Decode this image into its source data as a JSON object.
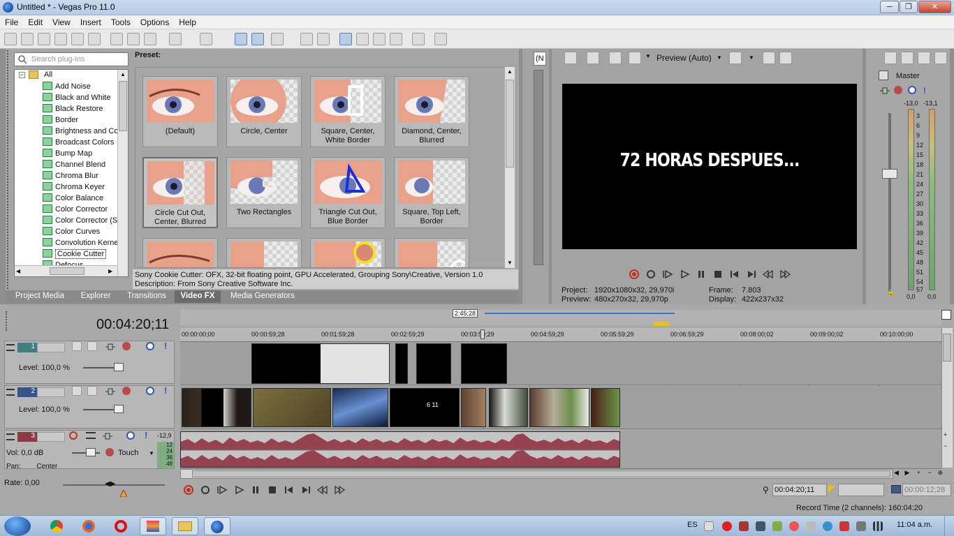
{
  "window": {
    "title": "Untitled * - Vegas Pro 11.0",
    "min_label": "─",
    "max_label": "❐",
    "close_label": "✕"
  },
  "menu": [
    "File",
    "Edit",
    "View",
    "Insert",
    "Tools",
    "Options",
    "Help"
  ],
  "plugins": {
    "search_placeholder": "Search plug-ins",
    "root": "All",
    "items": [
      "Add Noise",
      "Black and White",
      "Black Restore",
      "Border",
      "Brightness and Co",
      "Broadcast Colors",
      "Bump Map",
      "Channel Blend",
      "Chroma Blur",
      "Chroma Keyer",
      "Color Balance",
      "Color Corrector",
      "Color Corrector (S",
      "Color Curves",
      "Convolution Kerne",
      "Cookie Cutter",
      "Defocus"
    ],
    "selected": "Cookie Cutter"
  },
  "presets": {
    "label": "Preset:",
    "items": [
      {
        "name": "(Default)"
      },
      {
        "name": "Circle, Center"
      },
      {
        "name": "Square, Center, White Border"
      },
      {
        "name": "Diamond, Center, Blurred"
      },
      {
        "name": "Circle Cut Out, Center, Blurred"
      },
      {
        "name": "Two Rectangles"
      },
      {
        "name": "Triangle Cut Out, Blue Border"
      },
      {
        "name": "Square, Top Left, Border"
      },
      {
        "name": ""
      },
      {
        "name": ""
      },
      {
        "name": ""
      },
      {
        "name": ""
      }
    ],
    "description_line1": "Sony Cookie Cutter: OFX, 32-bit floating point, GPU Accelerated, Grouping Sony\\Creative, Version 1.0",
    "description_line2": "Description: From Sony Creative Software Inc."
  },
  "tabs": [
    "Project Media",
    "Explorer",
    "Transitions",
    "Video FX",
    "Media Generators"
  ],
  "active_tab": "Video FX",
  "preview": {
    "mode": "Preview (Auto)",
    "screen_text": "72 HORAS DESPUES...",
    "project_label": "Project:",
    "project_value": "1920x1080x32, 29,970i",
    "preview_label": "Preview:",
    "preview_value": "480x270x32, 29,970p",
    "frame_label": "Frame:",
    "frame_value": "7.803",
    "display_label": "Display:",
    "display_value": "422x237x32",
    "side_tab": "(N"
  },
  "master": {
    "label": "Master",
    "left_peak": "-13,0",
    "right_peak": "-13,1",
    "scale": [
      "3",
      "6",
      "9",
      "12",
      "15",
      "18",
      "21",
      "24",
      "27",
      "30",
      "33",
      "36",
      "39",
      "42",
      "45",
      "48",
      "51",
      "54",
      "57"
    ],
    "bottom_left": "0,0",
    "bottom_right": "0,0"
  },
  "timeline": {
    "current_time": "00:04:20;11",
    "selection_length": "2:45;28",
    "ruler": [
      "00:00:00;00",
      "00:00:59;28",
      "00:01:59;28",
      "00:02:59;29",
      "00:03:59;29",
      "00:04:59;29",
      "00:05:59;29",
      "00:06:59;29",
      "00:08:00;02",
      "00:09:00;02",
      "00:10:00;00"
    ],
    "tracks": [
      {
        "number": "1",
        "level_label": "Level:",
        "level_value": "100,0 %"
      },
      {
        "number": "2",
        "level_label": "Level:",
        "level_value": "100,0 %"
      },
      {
        "number": "3",
        "vol_label": "Vol:",
        "vol_value": "0,0 dB",
        "mode": "Touch",
        "pan_label": "Pan:",
        "pan_value": "Center",
        "meter_top": "-12,9",
        "meter_marks": [
          "12",
          "24",
          "36",
          "48"
        ]
      }
    ],
    "clip_overlay_text": "6 11",
    "rate_label": "Rate: 0,00",
    "cursor_time": "00:04:20;11",
    "end_time": "00:00:12;28",
    "record_time": "Record Time (2 channels): 160:04:20"
  },
  "taskbar": {
    "language": "ES",
    "clock": "11:04 a.m."
  },
  "colors": {
    "panel_bg": "#a6a6a6",
    "accent_blue": "#3f6fd1",
    "audio_wave": "#8c2b3c"
  }
}
